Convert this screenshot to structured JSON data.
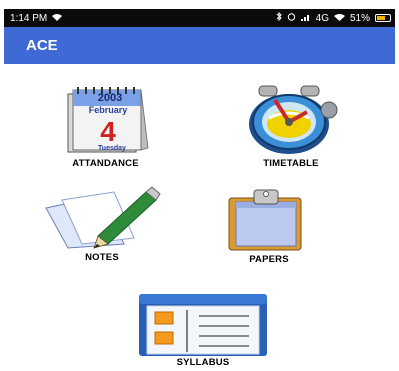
{
  "status_bar": {
    "time": "1:14 PM",
    "right_text": "4G",
    "battery": "51%"
  },
  "app_bar": {
    "title": "ACE"
  },
  "tiles": [
    {
      "id": "attendance",
      "label": "ATTANDANCE",
      "icon": "calendar-icon",
      "year": "2003",
      "month": "February",
      "day": "4",
      "weekday": "Tuesday"
    },
    {
      "id": "timetable",
      "label": "TIMETABLE",
      "icon": "clock-icon"
    },
    {
      "id": "notes",
      "label": "NOTES",
      "icon": "notepad-pen-icon"
    },
    {
      "id": "papers",
      "label": "PAPERS",
      "icon": "clipboard-icon"
    },
    {
      "id": "syllabus",
      "label": "SYLLABUS",
      "icon": "list-document-icon"
    }
  ]
}
